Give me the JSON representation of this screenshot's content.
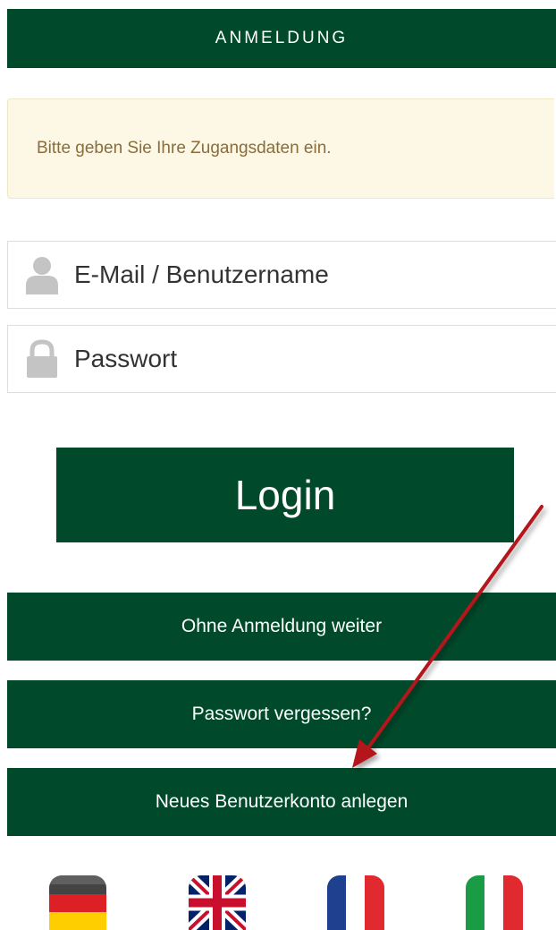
{
  "header": {
    "title": "ANMELDUNG"
  },
  "notice": {
    "text": "Bitte geben Sie Ihre Zugangsdaten ein."
  },
  "login_form": {
    "username_field": {
      "placeholder": "E-Mail / Benutzername",
      "icon": "user-icon"
    },
    "password_field": {
      "placeholder": "Passwort",
      "icon": "lock-icon"
    }
  },
  "buttons": {
    "login": "Login",
    "continue_without_login": "Ohne Anmeldung weiter",
    "forgot_password": "Passwort vergessen?",
    "create_account": "Neues Benutzerkonto anlegen"
  },
  "languages": [
    {
      "code": "de",
      "icon": "german-flag-icon"
    },
    {
      "code": "en",
      "icon": "uk-flag-icon"
    },
    {
      "code": "fr",
      "icon": "french-flag-icon"
    },
    {
      "code": "it",
      "icon": "italian-flag-icon"
    }
  ],
  "colors": {
    "brand_green": "#004a2b",
    "notice_bg": "#fcf8e5",
    "annotation_arrow": "#b5121b"
  }
}
